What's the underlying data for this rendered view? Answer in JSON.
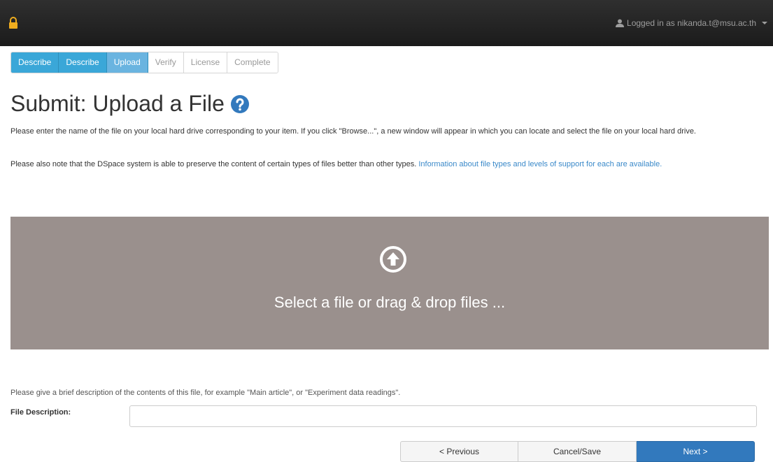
{
  "header": {
    "user_text": "Logged in as nikanda.t@msu.ac.th"
  },
  "steps": [
    {
      "label": "Describe",
      "state": "done"
    },
    {
      "label": "Describe",
      "state": "done"
    },
    {
      "label": "Upload",
      "state": "current"
    },
    {
      "label": "Verify",
      "state": "todo"
    },
    {
      "label": "License",
      "state": "todo"
    },
    {
      "label": "Complete",
      "state": "todo"
    }
  ],
  "main": {
    "title": "Submit: Upload a File",
    "intro": "Please enter the name of the file on your local hard drive corresponding to your item. If you click \"Browse...\", a new window will appear in which you can locate and select the file on your local hard drive.",
    "note_text": "Please also note that the DSpace system is able to preserve the content of certain types of files better than other types.",
    "note_link": "Information about file types and levels of support for each are available.",
    "dropzone_label": "Select a file or drag & drop files ...",
    "description_help": "Please give a brief description of the contents of this file, for example \"Main article\", or \"Experiment data readings\".",
    "file_description_label": "File Description:",
    "file_description_value": ""
  },
  "buttons": {
    "previous": "< Previous",
    "cancel_save": "Cancel/Save",
    "next": "Next >"
  },
  "colors": {
    "header_bg": "#222222",
    "step_done": "#3aa7d8",
    "step_current": "#6ab4e0",
    "dropzone_bg": "#9a908d",
    "primary_button": "#3279bd",
    "link": "#3a89c9",
    "lock": "#f0ad1e"
  },
  "icons": {
    "lock": "lock-icon",
    "user": "user-icon",
    "help": "question-circle-icon",
    "upload": "upload-arrow-circle-icon"
  }
}
